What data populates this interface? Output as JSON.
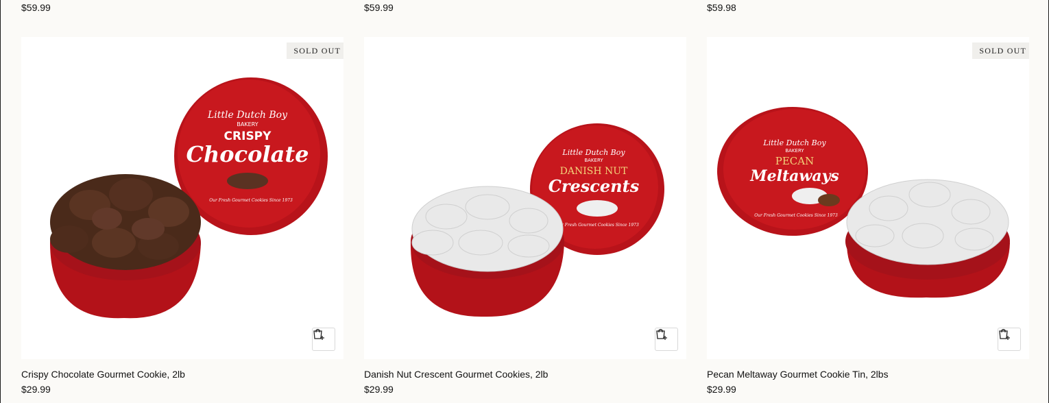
{
  "previous_row": {
    "prices": [
      "$59.99",
      "$59.99",
      "$59.98"
    ]
  },
  "products": [
    {
      "title": "Crispy Chocolate Gourmet Cookie, 2lb",
      "price": "$29.99",
      "badge": "SOLD OUT",
      "lid_text": {
        "brand": "Little Dutch Boy",
        "sub": "BAKERY",
        "line1": "CRISPY",
        "line2": "Chocolate",
        "tagline": "Our Fresh Gourmet Cookies Since 1973"
      }
    },
    {
      "title": "Danish Nut Crescent Gourmet Cookies, 2lb",
      "price": "$29.99",
      "badge": "",
      "lid_text": {
        "brand": "Little Dutch Boy",
        "sub": "BAKERY",
        "line1": "DANISH NUT",
        "line2": "Crescents",
        "tagline": "Our Fresh Gourmet Cookies Since 1973"
      }
    },
    {
      "title": "Pecan Meltaway Gourmet Cookie Tin, 2lbs",
      "price": "$29.99",
      "badge": "SOLD OUT",
      "lid_text": {
        "brand": "Little Dutch Boy",
        "sub": "BAKERY",
        "line1": "PECAN",
        "line2": "Meltaways",
        "tagline": "Our Fresh Gourmet Cookies Since 1973"
      }
    }
  ],
  "icons": {
    "quick_add": "quick-add-cart-icon"
  },
  "colors": {
    "tin_red": "#c0161b",
    "cookie_brown": "#4a2a1a",
    "sugar_white": "#eeeeee"
  }
}
